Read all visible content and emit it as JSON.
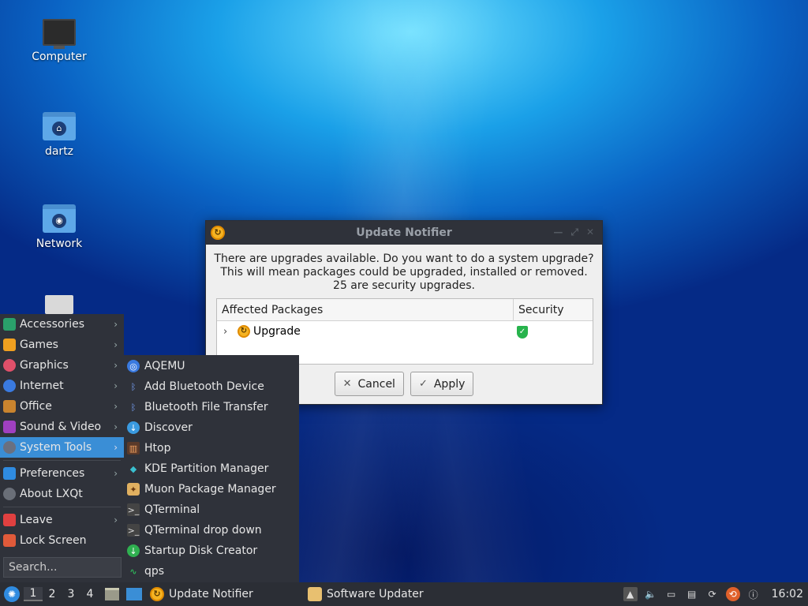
{
  "desktop": {
    "icons": [
      {
        "label": "Computer"
      },
      {
        "label": "dartz"
      },
      {
        "label": "Network"
      }
    ]
  },
  "dialog": {
    "title": "Update Notifier",
    "message_line1": "There are upgrades available. Do you want to do a system upgrade?",
    "message_line2": "This will mean packages could be upgraded, installed or removed.",
    "message_line3": "25 are security upgrades.",
    "table": {
      "col_packages": "Affected Packages",
      "col_security": "Security",
      "rows": [
        {
          "name": "Upgrade"
        }
      ]
    },
    "cancel_label": "Cancel",
    "apply_label": "Apply"
  },
  "menu": {
    "items": [
      {
        "label": "Accessories",
        "color": "#2aa06b"
      },
      {
        "label": "Games",
        "color": "#f0a020"
      },
      {
        "label": "Graphics",
        "color": "#e0506a"
      },
      {
        "label": "Internet",
        "color": "#3a7ae0"
      },
      {
        "label": "Office",
        "color": "#c9842e"
      },
      {
        "label": "Sound & Video",
        "color": "#a040c0"
      },
      {
        "label": "System Tools",
        "color": "#6a7080"
      },
      {
        "label": "Preferences",
        "color": "#2f8be0"
      },
      {
        "label": "About LXQt",
        "color": "#6a6f78"
      },
      {
        "label": "Leave",
        "color": "#e04040"
      },
      {
        "label": "Lock Screen",
        "color": "#e05a3a"
      }
    ],
    "search_placeholder": "Search..."
  },
  "submenu": {
    "items": [
      {
        "label": "AQEMU",
        "color": "#3a7ae0"
      },
      {
        "label": "Add Bluetooth Device",
        "color": "#2f5fb0"
      },
      {
        "label": "Bluetooth File Transfer",
        "color": "#2f5fb0"
      },
      {
        "label": "Discover",
        "color": "#3a9ae0"
      },
      {
        "label": "Htop",
        "color": "#c0603a"
      },
      {
        "label": "KDE Partition Manager",
        "color": "#2a9aa0"
      },
      {
        "label": "Muon Package Manager",
        "color": "#e0b060"
      },
      {
        "label": "QTerminal",
        "color": "#444"
      },
      {
        "label": "QTerminal drop down",
        "color": "#444"
      },
      {
        "label": "Startup Disk Creator",
        "color": "#2fb050"
      },
      {
        "label": "qps",
        "color": "#2fb050"
      }
    ]
  },
  "taskbar": {
    "desktops": [
      "1",
      "2",
      "3",
      "4"
    ],
    "tasks": [
      {
        "label": "Update Notifier"
      },
      {
        "label": "Software Updater"
      }
    ],
    "clock": "16:02"
  }
}
